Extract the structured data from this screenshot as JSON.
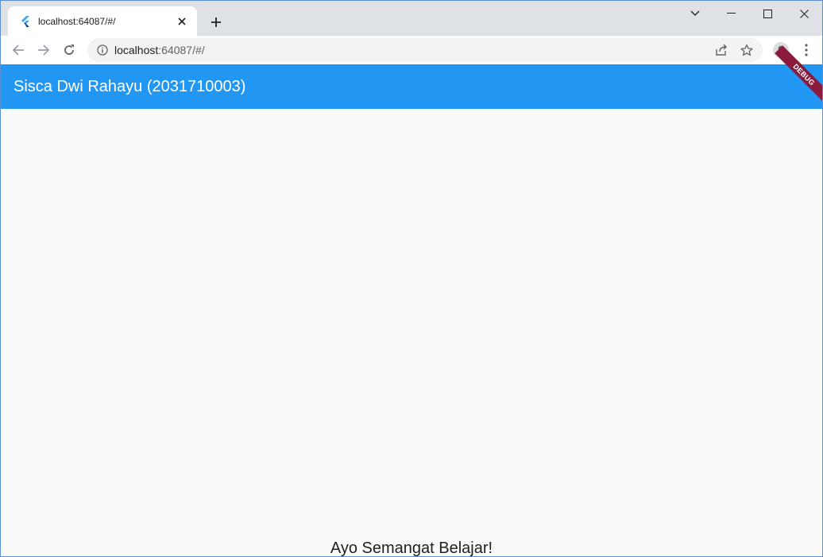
{
  "browser": {
    "tab": {
      "title": "localhost:64087/#/",
      "favicon": "flutter-icon"
    },
    "address": {
      "host": "localhost",
      "rest": ":64087/#/"
    },
    "icons": {
      "back": "arrow-left-icon",
      "forward": "arrow-right-icon",
      "reload": "reload-icon",
      "info": "info-icon",
      "share": "share-icon",
      "bookmark": "star-icon",
      "profile": "profile-icon",
      "menu": "kebab-menu-icon"
    }
  },
  "app": {
    "title": "Sisca Dwi Rahayu (2031710003)",
    "debug_label": "DEBUG",
    "body_text": "Ayo Semangat Belajar!",
    "colors": {
      "appbar": "#2196f3",
      "debug": "#8b1a3d",
      "background": "#fafafa"
    }
  }
}
